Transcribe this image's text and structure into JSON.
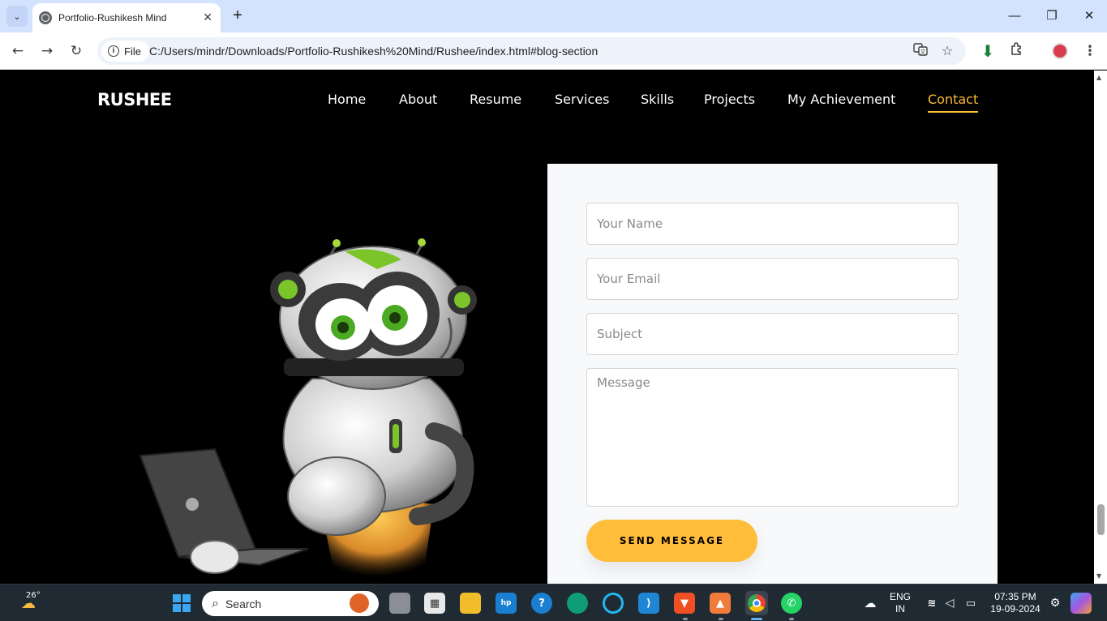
{
  "browser": {
    "tab_title": "Portfolio-Rushikesh Mind",
    "chip_label": "File",
    "url": "C:/Users/mindr/Downloads/Portfolio-Rushikesh%20Mind/Rushee/index.html#blog-section"
  },
  "site": {
    "logo": "RUSHEE",
    "nav": [
      {
        "label": "Home"
      },
      {
        "label": "About"
      },
      {
        "label": "Resume"
      },
      {
        "label": "Services"
      },
      {
        "label": "Skills"
      },
      {
        "label": "Projects"
      },
      {
        "label": "My Achievement"
      },
      {
        "label": "Contact",
        "active": true
      }
    ],
    "form": {
      "name_placeholder": "Your Name",
      "email_placeholder": "Your Email",
      "subject_placeholder": "Subject",
      "message_placeholder": "Message",
      "send_label": "SEND MESSAGE"
    }
  },
  "taskbar": {
    "weather": "26°",
    "search_label": "Search",
    "lang_top": "ENG",
    "lang_bottom": "IN",
    "time": "07:35 PM",
    "date": "19-09-2024"
  },
  "colors": {
    "accent": "#ffbd39",
    "page_bg": "#000000",
    "card_bg": "#f8f9fb"
  }
}
